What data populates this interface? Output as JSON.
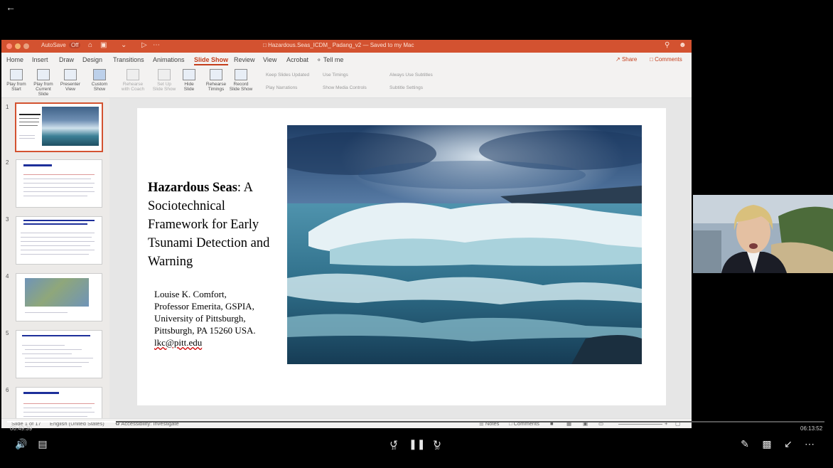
{
  "player": {
    "back_icon": "back-arrow-icon",
    "current_time": "00:49:39",
    "total_time": "06:13:52",
    "progress": 0.133,
    "skip_back_label": "10",
    "skip_forward_label": "30"
  },
  "ppt": {
    "titlebar": {
      "autosave": "AutoSave",
      "autosave_state": "Off",
      "document_title": "Hazardous.Seas_ICDM_ Padang_v2 — Saved to my Mac",
      "accent": "#d35230"
    },
    "menu": [
      {
        "label": "Home"
      },
      {
        "label": "Insert"
      },
      {
        "label": "Draw"
      },
      {
        "label": "Design"
      },
      {
        "label": "Transitions"
      },
      {
        "label": "Animations"
      },
      {
        "label": "Slide Show",
        "active": true
      },
      {
        "label": "Review"
      },
      {
        "label": "View"
      },
      {
        "label": "Acrobat"
      },
      {
        "label": "Tell me"
      }
    ],
    "share_label": "Share",
    "comments_label": "Comments",
    "ribbon": {
      "play_from_start": [
        "Play from",
        "Start"
      ],
      "play_from_current": [
        "Play from",
        "Current Slide"
      ],
      "presenter_view": [
        "Presenter",
        "View"
      ],
      "custom_show": [
        "Custom",
        "Show"
      ],
      "rehearse_with_coach": [
        "Rehearse",
        "with Coach"
      ],
      "set_up_slide_show": [
        "Set Up",
        "Slide Show"
      ],
      "hide_slide": [
        "Hide",
        "Slide"
      ],
      "rehearse_timings": [
        "Rehearse",
        "Timings"
      ],
      "record_slide_show": [
        "Record",
        "Slide Show"
      ],
      "keep_slides_updated": "Keep Slides Updated",
      "use_timings": "Use Timings",
      "play_narrations": "Play Narrations",
      "show_media_controls": "Show Media Controls",
      "always_use_subtitles": "Always Use Subtitles",
      "subtitle_settings": "Subtitle Settings"
    },
    "thumbnails": [
      {
        "num": "1"
      },
      {
        "num": "2"
      },
      {
        "num": "3"
      },
      {
        "num": "4"
      },
      {
        "num": "5"
      },
      {
        "num": "6"
      }
    ],
    "slide": {
      "title_bold": "Hazardous Seas",
      "title_rest": ": A Sociotechnical Framework for Early Tsunami Detection and Warning",
      "author_lines": [
        "Louise K. Comfort,",
        "Professor Emerita, GSPIA,",
        "University of Pittsburgh,",
        "Pittsburgh, PA 15260 USA."
      ],
      "email": "lkc@pitt.edu"
    },
    "status": {
      "slide_counter": "Slide 1 of 17",
      "language": "English (United States)",
      "accessibility": "Accessibility: Investigate",
      "notes": "Notes",
      "comments": "Comments"
    }
  }
}
